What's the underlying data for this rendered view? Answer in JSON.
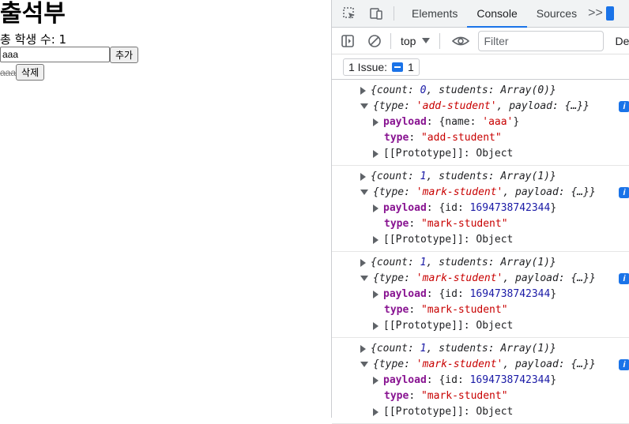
{
  "app": {
    "title": "출석부",
    "count_text": "총 학생 수: 1",
    "input_value": "aaa",
    "add_label": "추가",
    "student_name": "aaa",
    "delete_label": "삭제"
  },
  "devtools": {
    "tabs": [
      "Elements",
      "Console",
      "Sources"
    ],
    "more": ">>",
    "context": "top",
    "filter_placeholder": "Filter",
    "default_levels": "De",
    "issues_text": "1 Issue:",
    "issues_count": "1",
    "logs": [
      {
        "state_count": "0",
        "state_students": "Array(0)",
        "action_type": "'add-student'",
        "payload_preview": "{…}",
        "payload_key": "name",
        "payload_value": "'aaa'",
        "type_value": "\"add-student\"",
        "proto": "[[Prototype]]",
        "proto_value": "Object"
      },
      {
        "state_count": "1",
        "state_students": "Array(1)",
        "action_type": "'mark-student'",
        "payload_preview": "{…}",
        "payload_key": "id",
        "payload_value": "1694738742344",
        "type_value": "\"mark-student\"",
        "proto": "[[Prototype]]",
        "proto_value": "Object"
      },
      {
        "state_count": "1",
        "state_students": "Array(1)",
        "action_type": "'mark-student'",
        "payload_preview": "{…}",
        "payload_key": "id",
        "payload_value": "1694738742344",
        "type_value": "\"mark-student\"",
        "proto": "[[Prototype]]",
        "proto_value": "Object"
      },
      {
        "state_count": "1",
        "state_students": "Array(1)",
        "action_type": "'mark-student'",
        "payload_preview": "{…}",
        "payload_key": "id",
        "payload_value": "1694738742344",
        "type_value": "\"mark-student\"",
        "proto": "[[Prototype]]",
        "proto_value": "Object"
      }
    ]
  }
}
